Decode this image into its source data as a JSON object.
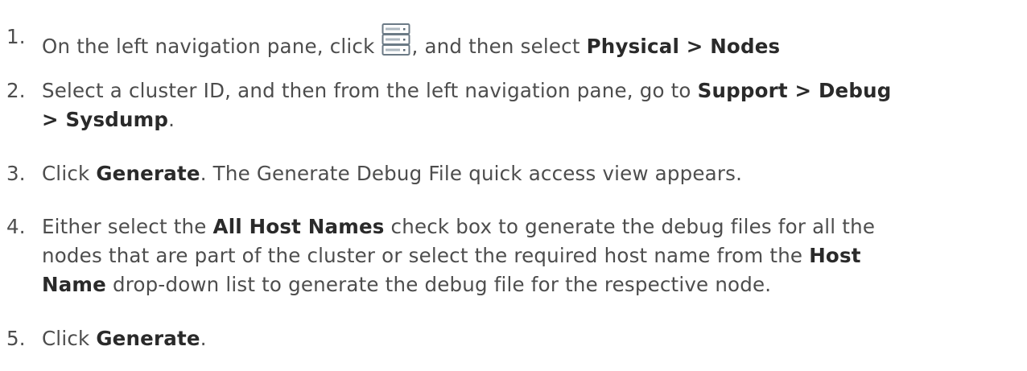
{
  "steps": [
    {
      "number": "1.",
      "text_before_icon": "On the left navigation pane, click ",
      "icon": "server-stack-icon",
      "text_after_icon": ", and then select ",
      "bold_1": "Physical > Nodes"
    },
    {
      "number": "2.",
      "text_1": "Select a cluster ID, and then from the left navigation pane, go to ",
      "bold_1": "Support > Debug",
      "bold_2": "> Sysdump",
      "text_end": "."
    },
    {
      "number": "3.",
      "text_1": "Click ",
      "bold_1": "Generate",
      "text_2": ". The Generate Debug File quick access view appears."
    },
    {
      "number": "4.",
      "text_1": "Either select the ",
      "bold_1": "All Host Names",
      "text_2": " check box to generate the debug files for all the",
      "line_2": "nodes that are part of the cluster or select the required host name from the ",
      "bold_2": "Host",
      "bold_3": "Name",
      "text_3": " drop-down list to generate the debug file for the respective node."
    },
    {
      "number": "5.",
      "text_1": "Click ",
      "bold_1": "Generate",
      "text_end": "."
    }
  ]
}
